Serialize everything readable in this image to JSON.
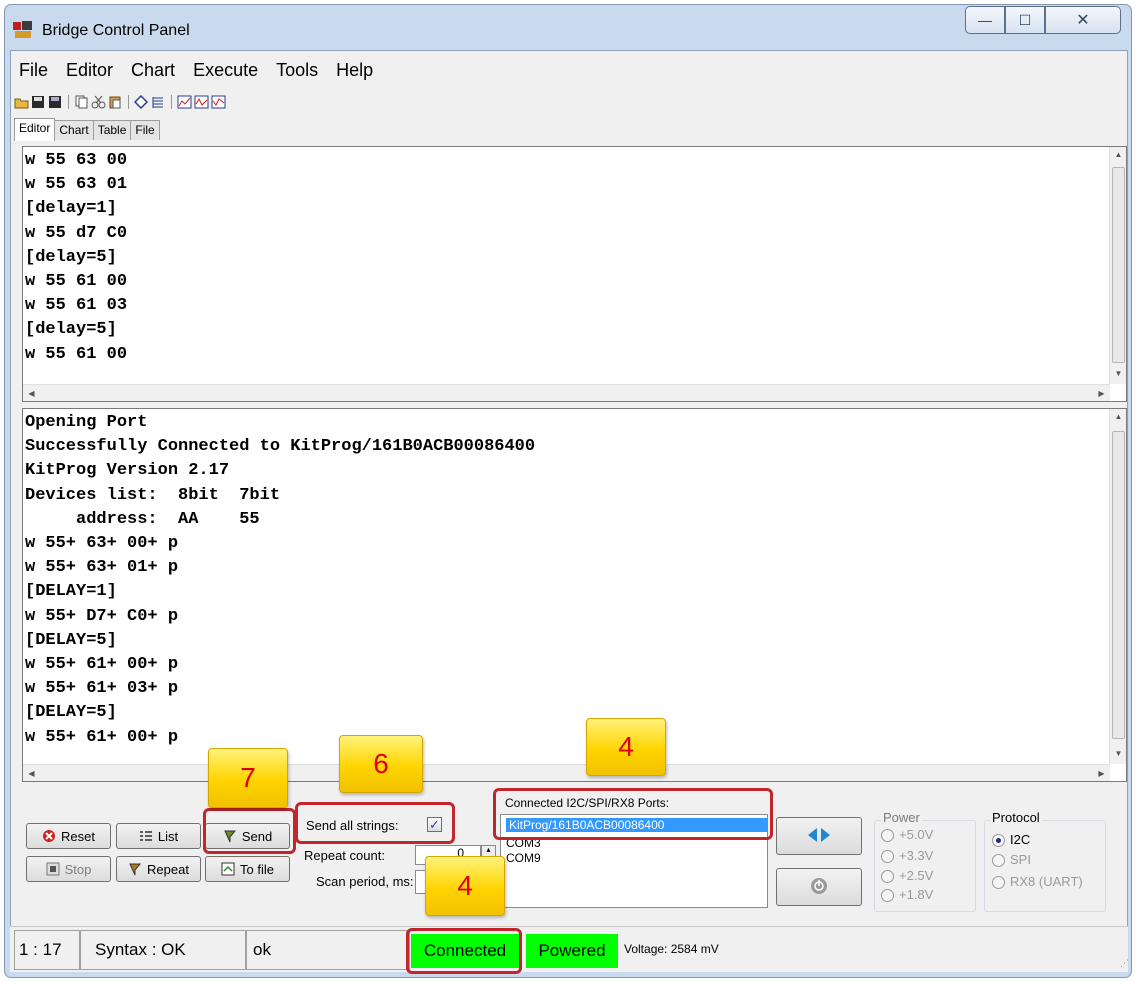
{
  "window": {
    "title": "Bridge Control Panel",
    "controls": {
      "minimize": "—",
      "maximize": "☐",
      "close": "✕"
    }
  },
  "menu": [
    "File",
    "Editor",
    "Chart",
    "Execute",
    "Tools",
    "Help"
  ],
  "toolbar_icons": [
    "open-icon",
    "save-icon",
    "save-all-icon",
    "copy-icon",
    "cut-icon",
    "paste-icon",
    "check-syntax-icon",
    "list-icon",
    "chart-icon",
    "chart-2-icon",
    "chart-3-icon"
  ],
  "tabs": [
    "Editor",
    "Chart",
    "Table",
    "File"
  ],
  "editor_text": "w 55 63 00\nw 55 63 01\n[delay=1]\nw 55 d7 C0\n[delay=5]\nw 55 61 00\nw 55 61 03\n[delay=5]\nw 55 61 00",
  "output_text": "Opening Port\nSuccessfully Connected to KitProg/161B0ACB00086400\nKitProg Version 2.17\nDevices list:  8bit  7bit\n     address:  AA    55\nw 55+ 63+ 00+ p\nw 55+ 63+ 01+ p\n[DELAY=1]\nw 55+ D7+ C0+ p\n[DELAY=5]\nw 55+ 61+ 00+ p\nw 55+ 61+ 03+ p\n[DELAY=5]\nw 55+ 61+ 00+ p",
  "buttons": {
    "reset": "Reset",
    "list": "List",
    "send": "Send",
    "stop": "Stop",
    "repeat": "Repeat",
    "to_file": "To file"
  },
  "options": {
    "send_all_strings_label": "Send all strings:",
    "send_all_strings_checked": true,
    "checkbox_glyph": "✓",
    "repeat_count_label": "Repeat count:",
    "repeat_count_value": "0",
    "scan_period_label": "Scan period, ms:"
  },
  "ports": {
    "label": "Connected I2C/SPI/RX8 Ports:",
    "items": [
      "KitProg/161B0ACB00086400",
      "COM3",
      "COM9"
    ],
    "selected_index": 0
  },
  "power": {
    "label": "Power",
    "options": [
      "+5.0V",
      "+3.3V",
      "+2.5V",
      "+1.8V"
    ]
  },
  "protocol": {
    "label": "Protocol",
    "options": [
      "I2C",
      "SPI",
      "RX8 (UART)"
    ],
    "selected": "I2C"
  },
  "status": {
    "position": "1 : 17",
    "syntax": "Syntax : OK",
    "message": "ok",
    "connected": "Connected",
    "powered": "Powered",
    "voltage": "Voltage: 2584 mV"
  },
  "callouts": [
    "7",
    "6",
    "4",
    "4"
  ],
  "colors": {
    "status_green": "#00ff00",
    "selection_blue": "#3399ff",
    "callout_yellow": "#ffd400",
    "callout_text": "#e00000",
    "highlight_red": "#c0262b"
  }
}
